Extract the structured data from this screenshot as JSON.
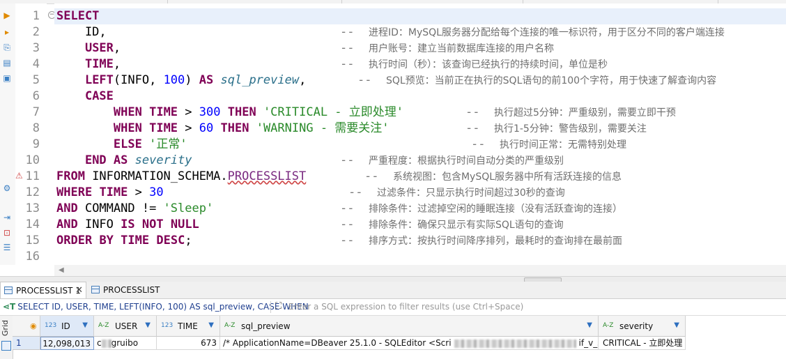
{
  "editor": {
    "line_numbers": [
      "1",
      "2",
      "3",
      "4",
      "5",
      "6",
      "7",
      "8",
      "9",
      "10",
      "11",
      "12",
      "13",
      "14",
      "15",
      "16"
    ],
    "comments": {
      "l2": "进程ID：MySQL服务器分配给每个连接的唯一标识符，用于区分不同的客户端连接",
      "l3": "用户账号：建立当前数据库连接的用户名称",
      "l4": "执行时间（秒）：该查询已经执行的持续时间，单位是秒",
      "l5": "SQL预览：当前正在执行的SQL语句的前100个字符，用于快速了解查询内容",
      "l7": "执行超过5分钟：严重级别，需要立即干预",
      "l8": "执行1-5分钟：警告级别，需要关注",
      "l9": "执行时间正常：无需特别处理",
      "l10": "严重程度：根据执行时间自动分类的严重级别",
      "l11": "系统视图：包含MySQL服务器中所有活跃连接的信息",
      "l12": "过滤条件：只显示执行时间超过30秒的查询",
      "l13": "排除条件：过滤掉空闲的睡眠连接（没有活跃查询的连接）",
      "l14": "排除条件：确保只显示有实际SQL语句的查询",
      "l15": "排序方式：按执行时间降序排列，最耗时的查询排在最前面"
    }
  },
  "tabs": [
    {
      "label": "PROCESSLIST 1",
      "close": "✕"
    },
    {
      "label": "PROCESSLIST 0"
    }
  ],
  "filter": {
    "query": "SELECT ID, USER, TIME, LEFT(INFO, 100) AS sql_preview, CASE WHEN",
    "placeholder": "Enter a SQL expression to filter results (use Ctrl+Space)"
  },
  "grid": {
    "vertical_tab": "Grid",
    "columns": [
      {
        "type": "123",
        "name": "ID"
      },
      {
        "type": "A-Z",
        "name": "USER"
      },
      {
        "type": "123",
        "name": "TIME"
      },
      {
        "type": "A-Z",
        "name": "sql_preview"
      },
      {
        "type": "A-Z",
        "name": "severity"
      }
    ],
    "rows": [
      {
        "num": "1",
        "id": "12,098,013",
        "user": "c",
        "user_tail": "gruibo",
        "time": "673",
        "sql_preview_start": "/* ApplicationName=DBeaver 25.1.0 - SQLEditor <Scri",
        "sql_preview_end": "if_v_sr",
        "severity": "CRITICAL - 立即处理"
      }
    ]
  },
  "colors": {
    "keyword": "#7f0055",
    "number": "#0000ff",
    "string": "#2a8a2a",
    "comment": "#7a7a7a",
    "current_line": "#e8f0fb"
  }
}
